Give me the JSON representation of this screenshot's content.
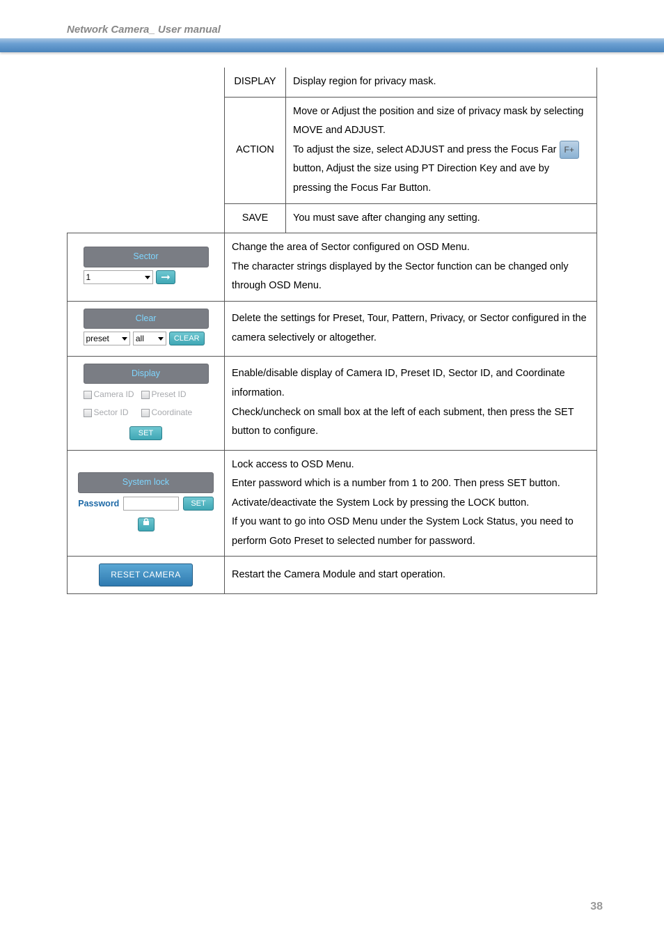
{
  "header": {
    "title": "Network Camera_ User manual"
  },
  "page_number": "38",
  "row1": {
    "display_lbl": "DISPLAY",
    "display_desc": "Display region for privacy mask.",
    "action_lbl": "ACTION",
    "action_p1": "Move or Adjust the position and size of privacy mask by selecting MOVE and ADJUST.",
    "action_p2a": "To adjust the size, select ADJUST and press the Focus Far ",
    "fplus": "F+",
    "action_p2b": " button, Adjust the size using PT Direction Key and ave by pressing the Focus Far Button.",
    "save_lbl": "SAVE",
    "save_desc": "You must save after changing any setting."
  },
  "sector": {
    "title": "Sector",
    "select_value": "1",
    "desc": "Change the area of Sector configured on OSD Menu.\nThe character strings displayed by the Sector function can be changed only through OSD Menu."
  },
  "clear": {
    "title": "Clear",
    "sel1": "preset",
    "sel2": "all",
    "btn": "CLEAR",
    "desc": "Delete the settings for Preset, Tour, Pattern, Privacy, or Sector configured in the camera selectively or altogether."
  },
  "display": {
    "title": "Display",
    "cb1": "Camera ID",
    "cb2": "Preset ID",
    "cb3": "Sector ID",
    "cb4": "Coordinate",
    "set": "SET",
    "desc": "Enable/disable display of Camera ID, Preset ID, Sector ID, and Coordinate information.\nCheck/uncheck on small box at the left of each subment, then press the SET button to configure."
  },
  "syslock": {
    "title": "System lock",
    "pwd_label": "Password",
    "set": "SET",
    "desc": "Lock access to OSD Menu.\nEnter password which is a number from 1 to 200. Then press SET button. Activate/deactivate the System Lock by pressing the LOCK button.\nIf you want to go into OSD Menu under the System Lock Status, you need to perform Goto Preset to selected number for password."
  },
  "reset": {
    "btn": "RESET CAMERA",
    "desc": "Restart the Camera Module and start operation."
  }
}
